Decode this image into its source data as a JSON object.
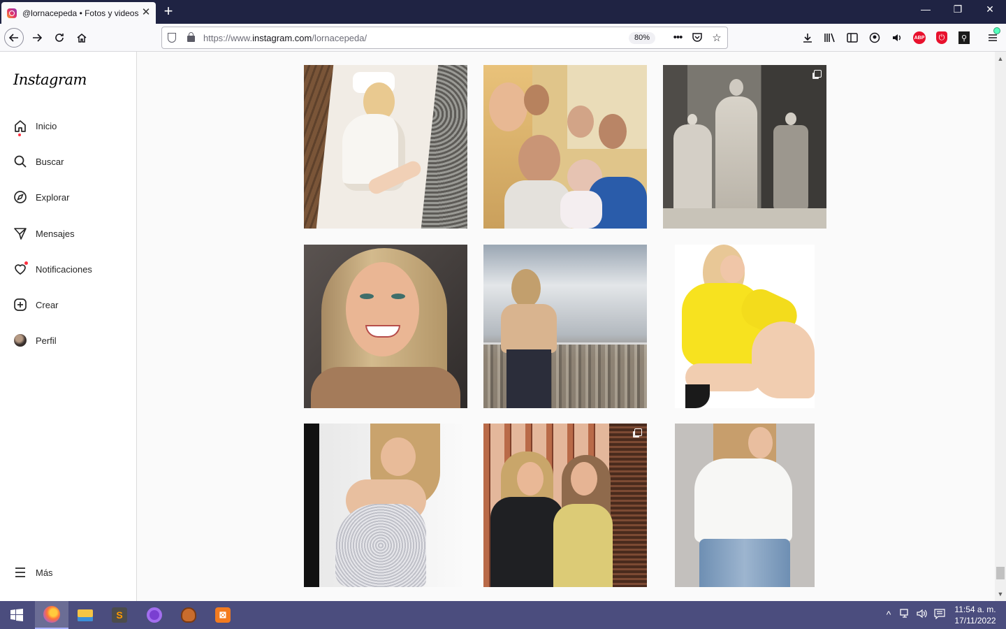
{
  "browser": {
    "tab_title": "@lornacepeda • Fotos y videos",
    "tab_close": "✕",
    "new_tab": "+",
    "url_prefix": "https://www.",
    "url_domain": "instagram.com",
    "url_path": "/lornacepeda/",
    "zoom": "80%",
    "window_controls": {
      "minimize": "—",
      "maximize": "❐",
      "close": "✕"
    }
  },
  "instagram": {
    "logo": "Instagram",
    "nav": [
      {
        "label": "Inicio",
        "icon": "home-icon",
        "notification_dot": true
      },
      {
        "label": "Buscar",
        "icon": "search-icon"
      },
      {
        "label": "Explorar",
        "icon": "compass-icon"
      },
      {
        "label": "Mensajes",
        "icon": "send-icon"
      },
      {
        "label": "Notificaciones",
        "icon": "heart-icon",
        "notification_dot": true
      },
      {
        "label": "Crear",
        "icon": "plus-square-icon"
      },
      {
        "label": "Perfil",
        "icon": "avatar"
      }
    ],
    "more": {
      "label": "Más",
      "icon": "menu-icon"
    },
    "posts": [
      {
        "description": "spa-lounger-photo",
        "multi": false
      },
      {
        "description": "family-selfie-photo",
        "multi": false
      },
      {
        "description": "vintage-bw-photo",
        "multi": true
      },
      {
        "description": "smiling-selfie-photo",
        "multi": false
      },
      {
        "description": "city-balcony-photo",
        "multi": false
      },
      {
        "description": "yellow-sweater-photo",
        "multi": false
      },
      {
        "description": "sequin-outfit-photo",
        "multi": false
      },
      {
        "description": "two-women-doorway-photo",
        "multi": true
      },
      {
        "description": "white-tee-jeans-photo",
        "multi": false
      }
    ]
  },
  "taskbar": {
    "apps": [
      "windows-start",
      "firefox",
      "file-explorer",
      "sublime-text",
      "github-desktop",
      "baseball-app",
      "xampp"
    ],
    "clock_time": "11:54 a. m.",
    "clock_date": "17/11/2022"
  },
  "colors": {
    "tabbar": "#1f2343",
    "taskbar": "#4b4d7e",
    "notification": "#ff3040"
  }
}
